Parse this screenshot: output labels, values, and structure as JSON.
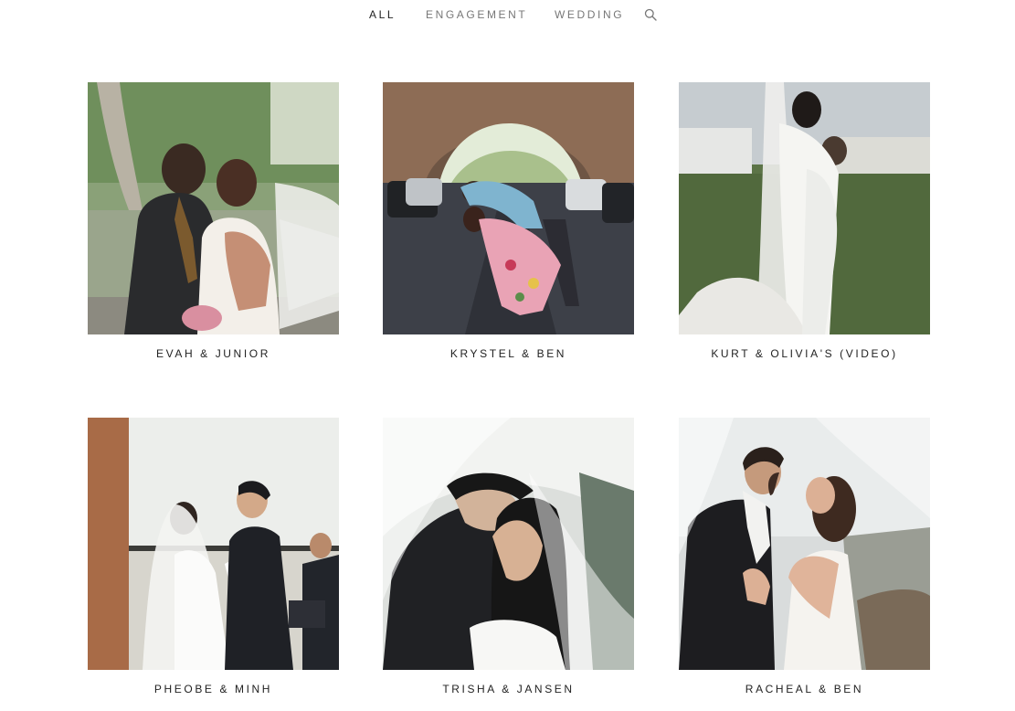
{
  "filter_nav": {
    "items": [
      {
        "label": "ALL",
        "active": true
      },
      {
        "label": "ENGAGEMENT",
        "active": false
      },
      {
        "label": "WEDDING",
        "active": false
      }
    ],
    "search_icon": "search-icon"
  },
  "gallery": {
    "items": [
      {
        "caption": "EVAH & JUNIOR"
      },
      {
        "caption": "KRYSTEL & BEN"
      },
      {
        "caption": "KURT & OLIVIA'S (VIDEO)"
      },
      {
        "caption": "PHEOBE & MINH"
      },
      {
        "caption": "TRISHA & JANSEN"
      },
      {
        "caption": "RACHEAL & BEN"
      }
    ]
  }
}
